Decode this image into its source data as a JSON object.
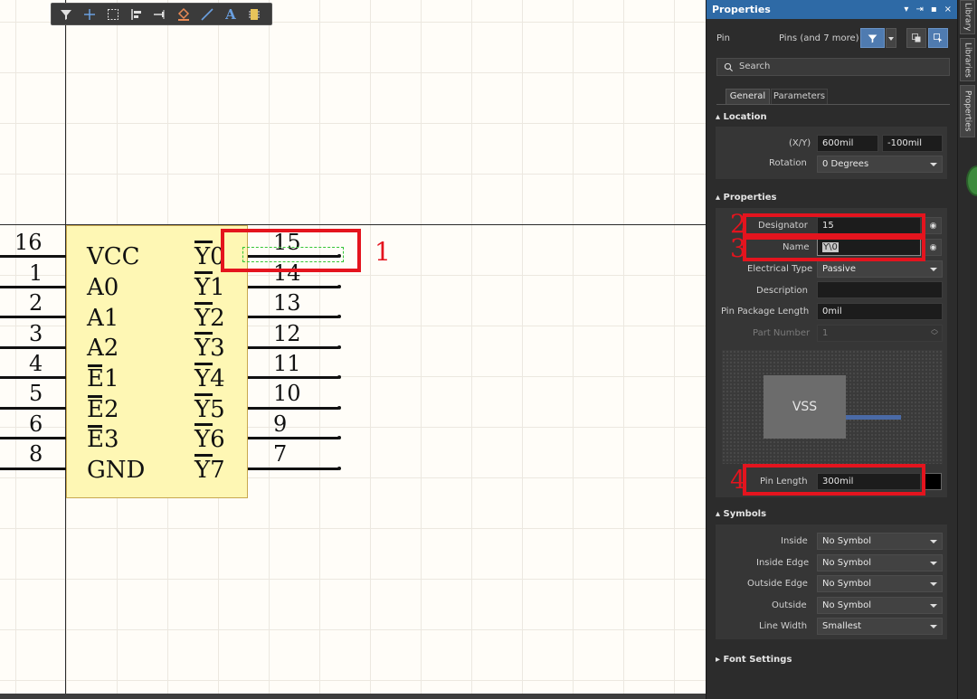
{
  "canvas": {
    "component": {
      "left_pins": [
        {
          "number": "16",
          "name": "VCC",
          "overbar": false
        },
        {
          "number": "1",
          "name": "A0",
          "overbar": false
        },
        {
          "number": "2",
          "name": "A1",
          "overbar": false
        },
        {
          "number": "3",
          "name": "A2",
          "overbar": false
        },
        {
          "number": "4",
          "name": "E1",
          "overbar": true
        },
        {
          "number": "5",
          "name": "E2",
          "overbar": true
        },
        {
          "number": "6",
          "name": "E3",
          "overbar": false
        },
        {
          "number": "8",
          "name": "GND",
          "overbar": false
        }
      ],
      "right_pins": [
        {
          "number": "15",
          "name": "Y0"
        },
        {
          "number": "14",
          "name": "Y1"
        },
        {
          "number": "13",
          "name": "Y2"
        },
        {
          "number": "12",
          "name": "Y3"
        },
        {
          "number": "11",
          "name": "Y4"
        },
        {
          "number": "10",
          "name": "Y5"
        },
        {
          "number": "9",
          "name": "Y6"
        },
        {
          "number": "7",
          "name": "Y7"
        }
      ]
    },
    "annotations": [
      "1",
      "2",
      "3",
      "4"
    ],
    "annotation_color": "#e4141e",
    "toolbar": {
      "icons": [
        "filter-icon",
        "cross-icon",
        "select-rect-icon",
        "align-icon",
        "pin-icon",
        "fill-icon",
        "line-icon",
        "text-icon",
        "part-icon"
      ],
      "text_tool_glyph": "A"
    }
  },
  "panel": {
    "title": "Properties",
    "controls": [
      "▾",
      "⇥",
      "▪",
      "×"
    ],
    "object_type": "Pin",
    "object_count": "Pins (and 7 more)",
    "search_placeholder": "Search",
    "tabs": [
      "General",
      "Parameters"
    ],
    "location": {
      "header": "Location",
      "xy_label": "(X/Y)",
      "x": "600mil",
      "y": "-100mil",
      "rotation_label": "Rotation",
      "rotation": "0 Degrees"
    },
    "properties": {
      "header": "Properties",
      "designator_label": "Designator",
      "designator": "15",
      "name_label": "Name",
      "name": "Y\\0",
      "electrical_type_label": "Electrical Type",
      "electrical_type": "Passive",
      "description_label": "Description",
      "description": "",
      "pin_package_length_label": "Pin Package Length",
      "pin_package_length": "0mil",
      "part_number_label": "Part Number",
      "part_number": "1",
      "preview_text": "VSS",
      "pin_length_label": "Pin Length",
      "pin_length": "300mil"
    },
    "symbols": {
      "header": "Symbols",
      "inside_label": "Inside",
      "inside": "No Symbol",
      "inside_edge_label": "Inside Edge",
      "inside_edge": "No Symbol",
      "outside_edge_label": "Outside Edge",
      "outside_edge": "No Symbol",
      "outside_label": "Outside",
      "outside": "No Symbol",
      "line_width_label": "Line Width",
      "line_width": "Smallest"
    },
    "font_settings": {
      "header": "Font Settings"
    }
  },
  "side_tabs": [
    "Library",
    "Libraries",
    "Properties"
  ],
  "colors": {
    "panel_title_bg": "#2e6aa6",
    "component_fill": "#fef7b4",
    "selection_dash": "#35c535",
    "preview_line": "#4a6aa6"
  }
}
